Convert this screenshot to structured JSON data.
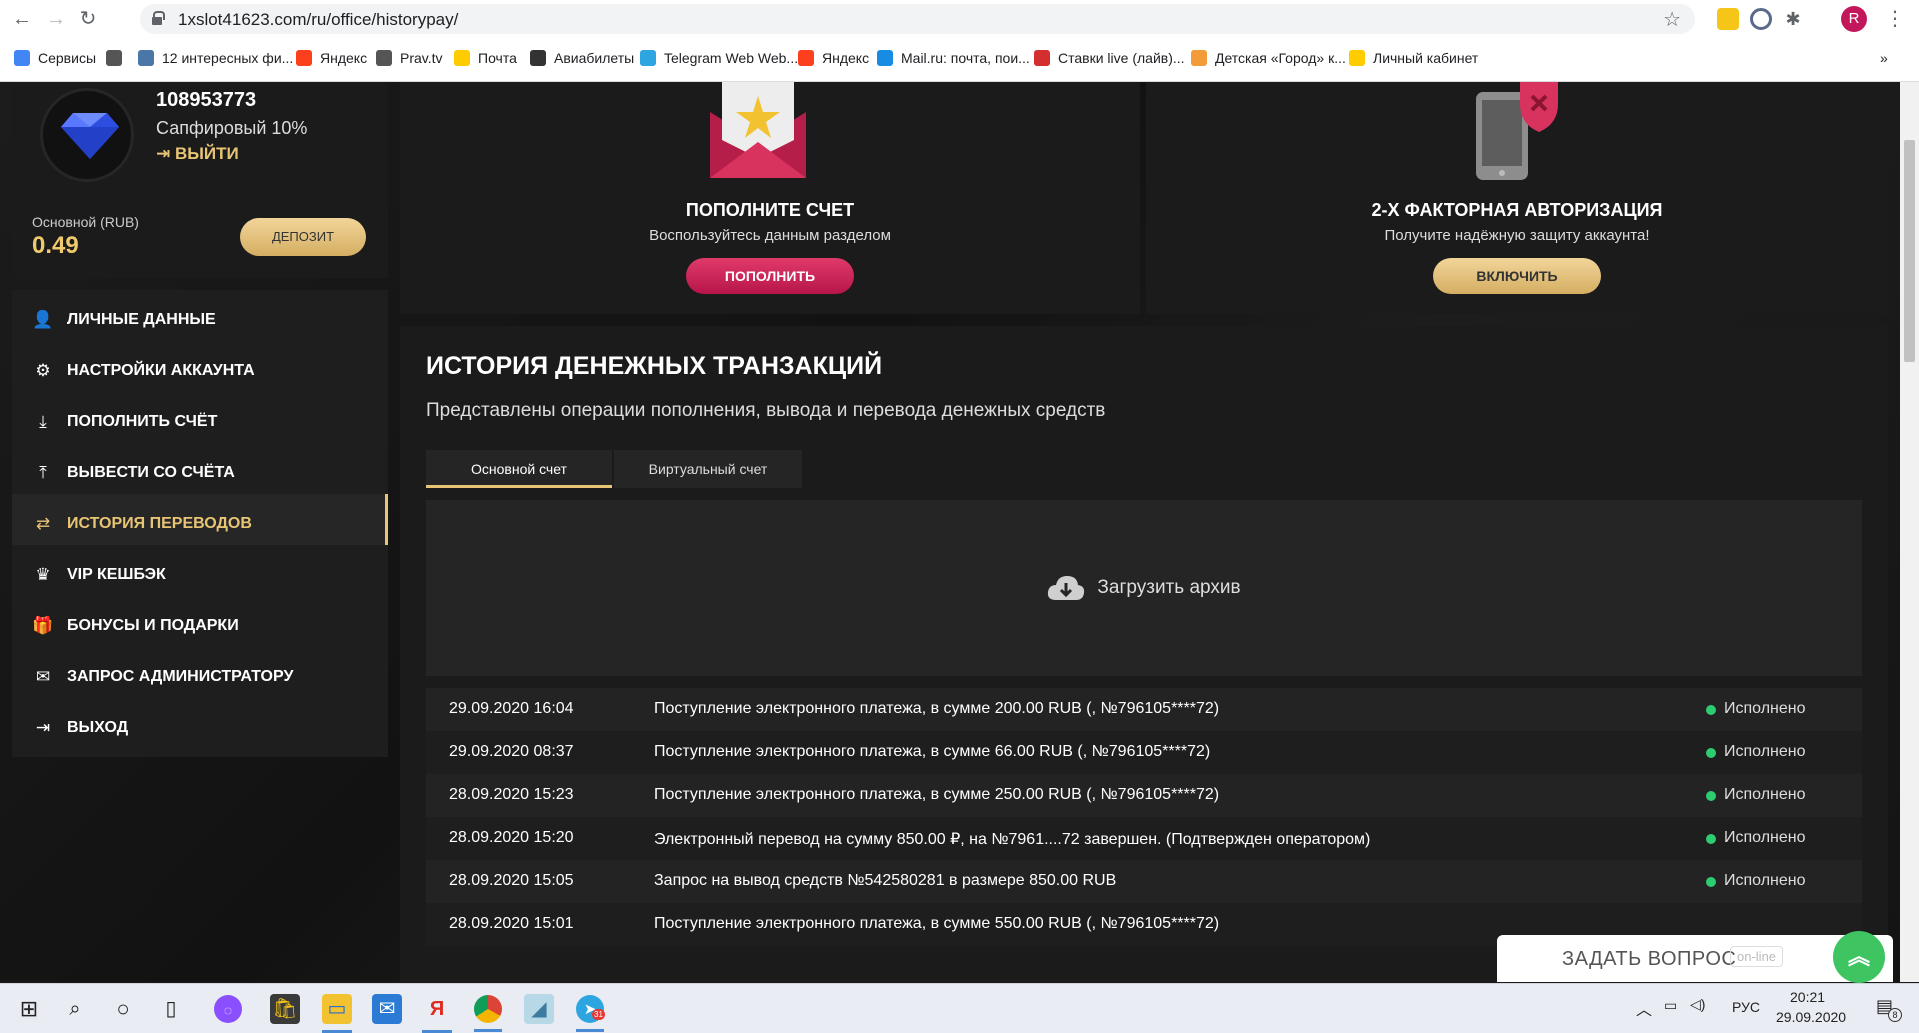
{
  "browser": {
    "url": "1xslot41623.com/ru/office/historypay/",
    "profile_initial": "R",
    "bookmarks": [
      {
        "label": "Сервисы",
        "icon": "apps-grid-icon",
        "color": "#4285f4"
      },
      {
        "label": "",
        "icon": "globe-icon",
        "color": "#555555"
      },
      {
        "label": "12 интересных фи...",
        "icon": "vk-icon",
        "color": "#4a76a8"
      },
      {
        "label": "Яндекс",
        "icon": "yandex-icon",
        "color": "#fc3f1d"
      },
      {
        "label": "Prav.tv",
        "icon": "globe-icon",
        "color": "#555555"
      },
      {
        "label": "Почта",
        "icon": "mail-icon",
        "color": "#ffcc00"
      },
      {
        "label": "Авиабилеты",
        "icon": "plane-icon",
        "color": "#333333"
      },
      {
        "label": "Telegram Web Web...",
        "icon": "telegram-icon",
        "color": "#2ca5e0"
      },
      {
        "label": "Яндекс",
        "icon": "yandex-icon",
        "color": "#fc3f1d"
      },
      {
        "label": "Mail.ru: почта, пои...",
        "icon": "mailru-icon",
        "color": "#168de2"
      },
      {
        "label": "Ставки live (лайв)...",
        "icon": "m-icon",
        "color": "#d32f2f"
      },
      {
        "label": "Детская «Город» к...",
        "icon": "city-icon",
        "color": "#f29b38"
      },
      {
        "label": "Личный кабинет",
        "icon": "shield-logo-icon",
        "color": "#ffcc00"
      }
    ],
    "more": "»"
  },
  "profile": {
    "user_id": "108953773",
    "level": "Сапфировый 10%",
    "logout": "ВЫЙТИ",
    "balance_label": "Основной (RUB)",
    "balance_value": "0.49",
    "deposit_button": "ДЕПОЗИТ"
  },
  "menu": [
    {
      "label": "Личные данные",
      "icon": "user-icon",
      "glyph": "👤",
      "active": false
    },
    {
      "label": "Настройки аккаунта",
      "icon": "gears-icon",
      "glyph": "⚙",
      "active": false
    },
    {
      "label": "Пополнить счёт",
      "icon": "download-icon",
      "glyph": "⤓",
      "active": false
    },
    {
      "label": "Вывести со счёта",
      "icon": "upload-icon",
      "glyph": "⤒",
      "active": false
    },
    {
      "label": "История переводов",
      "icon": "transfer-icon",
      "glyph": "⇄",
      "active": true
    },
    {
      "label": "VIP кешбэк",
      "icon": "crown-icon",
      "glyph": "♛",
      "active": false
    },
    {
      "label": "Бонусы и подарки",
      "icon": "gift-icon",
      "glyph": "🎁",
      "active": false
    },
    {
      "label": "Запрос администратору",
      "icon": "envelope-icon",
      "glyph": "✉",
      "active": false
    },
    {
      "label": "Выход",
      "icon": "exit-icon",
      "glyph": "⇥",
      "active": false
    }
  ],
  "promo": {
    "left": {
      "title": "ПОПОЛНИТЕ СЧЕТ",
      "subtitle": "Воспользуйтесь данным разделом",
      "button": "ПОПОЛНИТЬ"
    },
    "right": {
      "title": "2-Х ФАКТОРНАЯ АВТОРИЗАЦИЯ",
      "subtitle": "Получите надёжную защиту аккаунта!",
      "button": "ВКЛЮЧИТЬ"
    }
  },
  "history": {
    "title": "ИСТОРИЯ ДЕНЕЖНЫХ ТРАНЗАКЦИЙ",
    "subtitle": "Представлены операции пополнения, вывода и перевода денежных средств",
    "tabs": [
      "Основной счет",
      "Виртуальный счет"
    ],
    "archive": "Загрузить архив",
    "rows": [
      {
        "date": "29.09.2020 16:04",
        "description": "Поступление электронного платежа, в сумме 200.00 RUB (, №796105****72)",
        "status": "Исполнено"
      },
      {
        "date": "29.09.2020 08:37",
        "description": "Поступление электронного платежа, в сумме 66.00 RUB (, №796105****72)",
        "status": "Исполнено"
      },
      {
        "date": "28.09.2020 15:23",
        "description": "Поступление электронного платежа, в сумме 250.00 RUB (, №796105****72)",
        "status": "Исполнено"
      },
      {
        "date": "28.09.2020 15:20",
        "description": "Электронный перевод на сумму 850.00 ₽, на №7961....72 завершен. (Подтвержден оператором)",
        "status": "Исполнено"
      },
      {
        "date": "28.09.2020 15:05",
        "description": "Запрос на вывод средств №542580281 в размере 850.00 RUB",
        "status": "Исполнено"
      },
      {
        "date": "28.09.2020 15:01",
        "description": "Поступление электронного платежа, в сумме 550.00 RUB (, №796105****72)",
        "status": ""
      }
    ]
  },
  "chat": {
    "label": "ЗАДАТЬ ВОПРОС",
    "status": "on-line"
  },
  "taskbar": {
    "language": "РУС",
    "time": "20:21",
    "date": "29.09.2020",
    "telegram_badge": "31",
    "notification_count": "8"
  },
  "colors": {
    "accent": "#e8c475",
    "pink": "#d62a5c",
    "status_ok": "#2ecc71"
  }
}
